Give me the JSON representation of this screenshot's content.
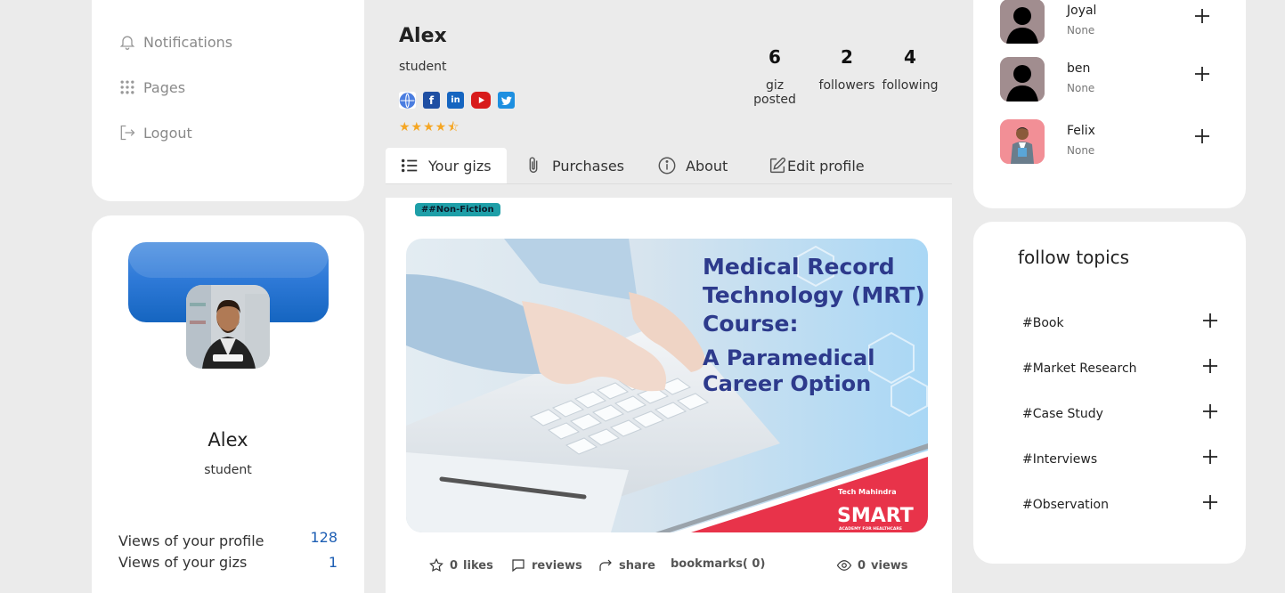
{
  "left_nav": {
    "items": [
      {
        "label": "Notifications",
        "icon": "bell-icon"
      },
      {
        "label": "Pages",
        "icon": "grid-dots-icon"
      },
      {
        "label": "Logout",
        "icon": "logout-icon"
      }
    ]
  },
  "profile_card": {
    "name": "Alex",
    "role": "student",
    "stats": [
      {
        "label": "Views of your profile",
        "value": "128"
      },
      {
        "label": "Views of your gizs",
        "value": "1"
      }
    ]
  },
  "header": {
    "name": "Alex",
    "role": "student",
    "socials": [
      "globe-icon",
      "facebook-icon",
      "linkedin-icon",
      "youtube-icon",
      "twitter-icon"
    ],
    "rating": 4.5,
    "stats": [
      {
        "value": "6",
        "label": "giz posted"
      },
      {
        "value": "2",
        "label": "followers"
      },
      {
        "value": "4",
        "label": "following"
      }
    ]
  },
  "tabs": [
    {
      "label": "Your gizs",
      "icon": "list-icon",
      "active": true
    },
    {
      "label": "Purchases",
      "icon": "paperclip-icon",
      "active": false
    },
    {
      "label": "About",
      "icon": "info-icon",
      "active": false
    },
    {
      "label": "Edit profile",
      "icon": "edit-icon",
      "active": false
    }
  ],
  "post": {
    "tag": "##Non-Fiction",
    "image": {
      "line1": "Medical Record",
      "line2": "Technology (MRT)",
      "line3": "Course:",
      "line4": "A Paramedical",
      "line5": "Career Option",
      "brand_small": "Tech Mahindra",
      "brand_big": "SMART",
      "brand_sub": "ACADEMY FOR HEALTHCARE"
    },
    "actions": {
      "likes_count": "0",
      "likes_label": "likes",
      "reviews_label": "reviews",
      "share_label": "share",
      "bookmarks_label": "bookmarks( 0)",
      "views_count": "0",
      "views_label": "views"
    }
  },
  "people": [
    {
      "name": "Joyal",
      "sub": "None"
    },
    {
      "name": "ben",
      "sub": "None"
    },
    {
      "name": "Felix",
      "sub": "None"
    }
  ],
  "topics": {
    "title": "follow topics",
    "items": [
      "#Book",
      "#Market Research",
      "#Case Study",
      "#Interviews",
      "#Observation"
    ]
  },
  "colors": {
    "accent_blue": "#1e5fb4",
    "star": "#f5a623",
    "tag_bg": "#1e9fa8",
    "brand_red": "#e8334a"
  }
}
